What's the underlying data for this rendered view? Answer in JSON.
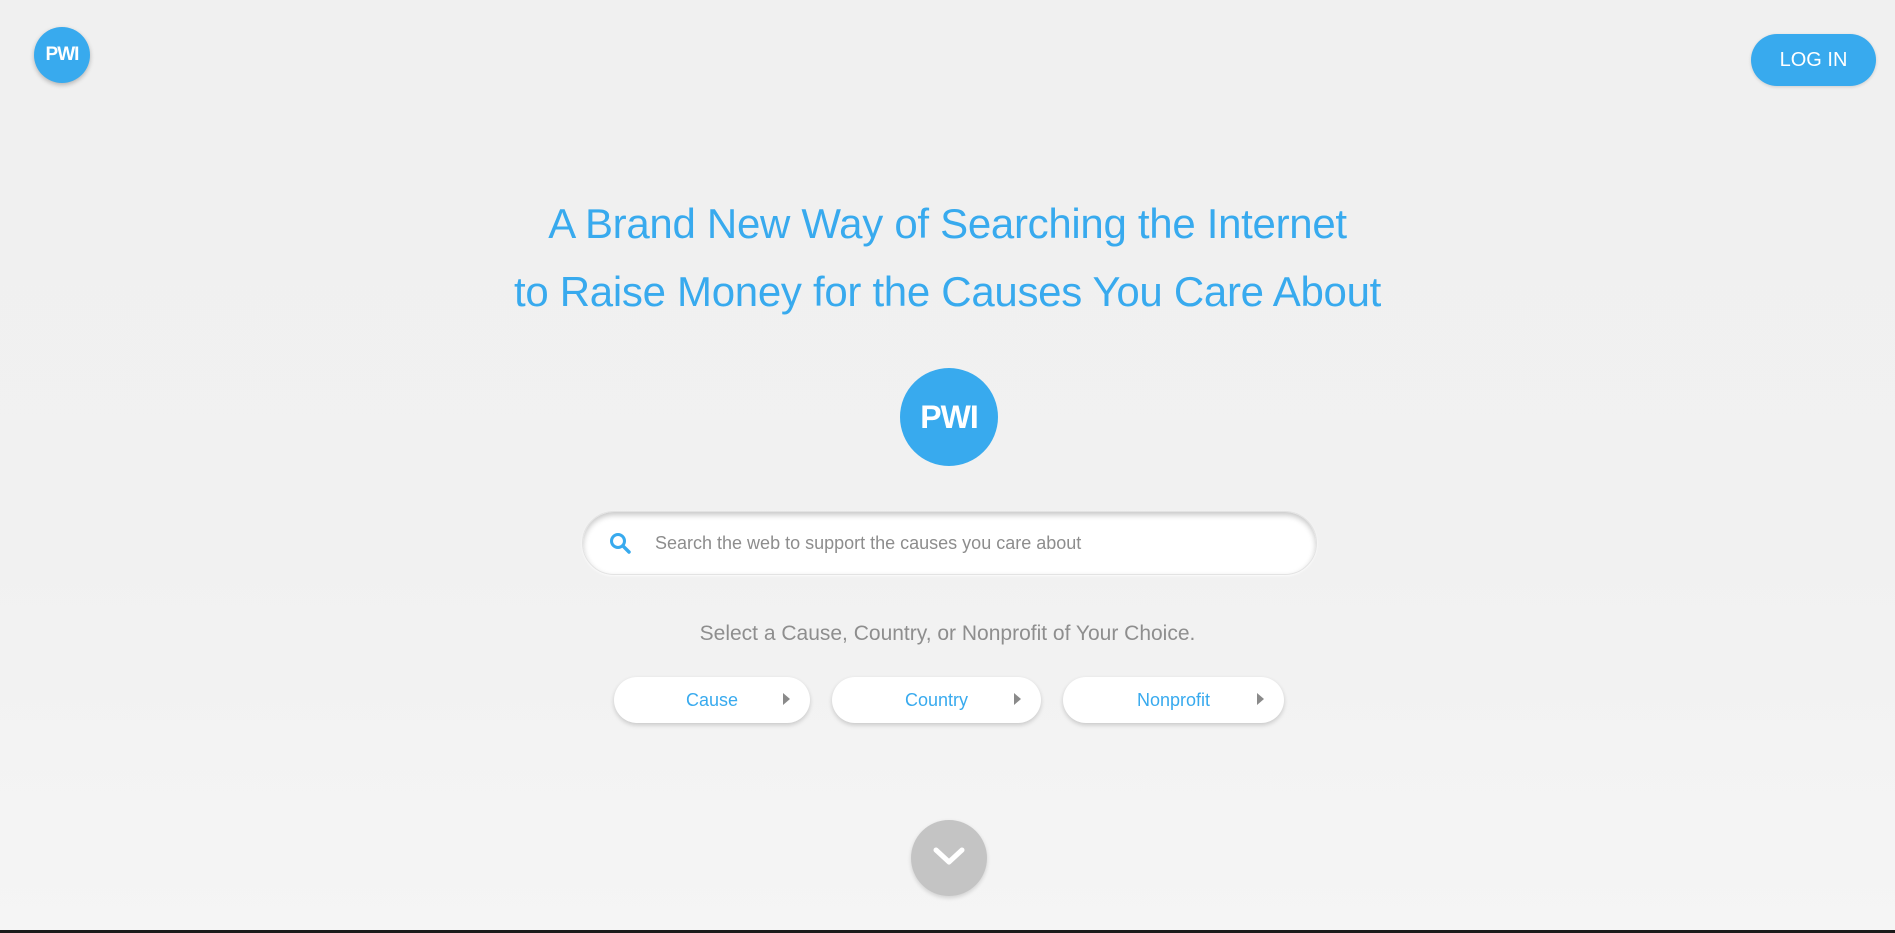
{
  "header": {
    "logo_text": "PWI",
    "login_label": "LOG IN"
  },
  "hero": {
    "headline_line1": "A Brand New Way of Searching the Internet",
    "headline_line2": "to Raise Money for the Causes You Care About",
    "logo_text": "PWI"
  },
  "search": {
    "placeholder": "Search the web to support the causes you care about",
    "value": "",
    "icon": "search-icon"
  },
  "selector": {
    "prompt": "Select a Cause, Country, or Nonprofit of Your Choice.",
    "options": [
      {
        "label": "Cause",
        "icon": "caret-right-icon"
      },
      {
        "label": "Country",
        "icon": "caret-right-icon"
      },
      {
        "label": "Nonprofit",
        "icon": "caret-right-icon"
      }
    ]
  },
  "scroll": {
    "icon": "chevron-down-icon"
  },
  "colors": {
    "brand": "#38aaee",
    "background": "#f0f0f0",
    "muted_text": "#8e8e8e",
    "scroll_button": "#c4c4c4"
  }
}
